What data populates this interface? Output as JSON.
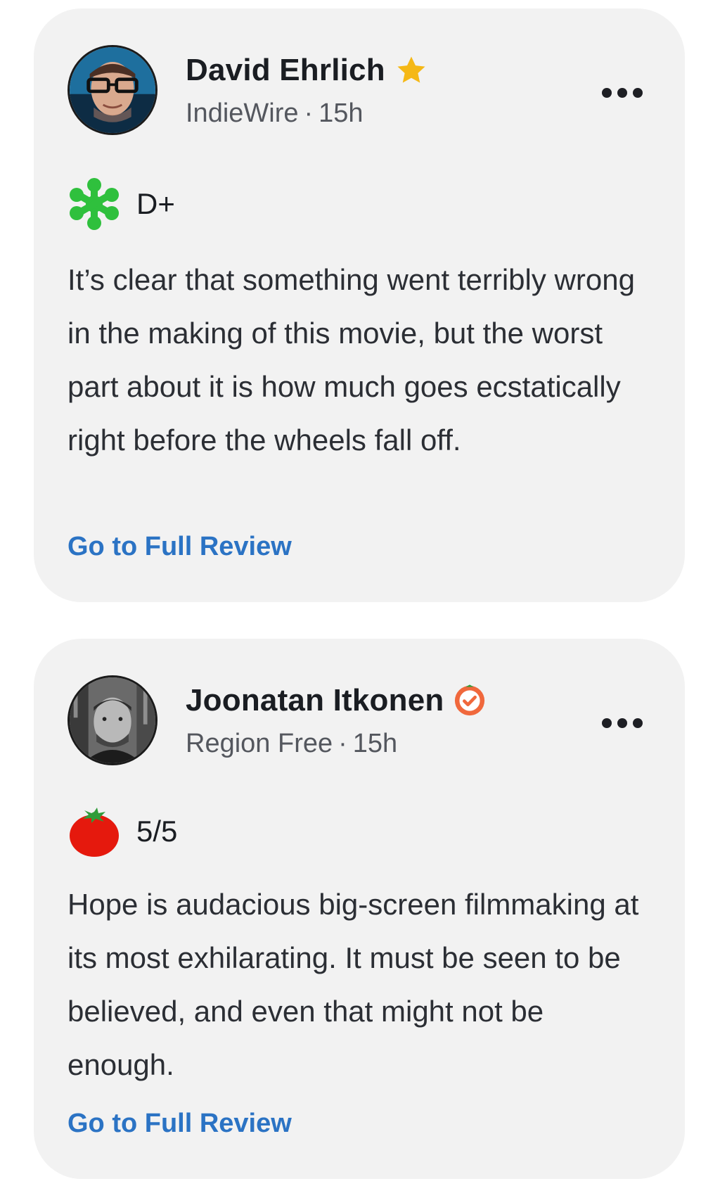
{
  "reviews": [
    {
      "critic_name": "David Ehrlich",
      "name_badge_icon": "star-icon",
      "publication": "IndieWire",
      "separator": "·",
      "time_ago": "15h",
      "score_icon": "splat-icon",
      "score": "D+",
      "quote": "It’s clear that something went terribly wrong in the making of this movie, but the worst part about it is how much goes ecstatically right before the wheels fall off.",
      "link_label": "Go to Full Review"
    },
    {
      "critic_name": "Joonatan Itkonen",
      "name_badge_icon": "verified-check-icon",
      "publication": "Region Free",
      "separator": "·",
      "time_ago": "15h",
      "score_icon": "tomato-icon",
      "score": "5/5",
      "quote": "Hope is audacious big-screen filmmaking at its most exhilarating. It must be seen to be believed, and even that might not be enough.",
      "link_label": "Go to Full Review"
    }
  ],
  "colors": {
    "card_background": "#f2f2f2",
    "link": "#2b73c4",
    "splat_green": "#2fc03d",
    "tomato_red": "#e5190d",
    "star_gold": "#f5b816",
    "verified_orange": "#f0683c"
  }
}
